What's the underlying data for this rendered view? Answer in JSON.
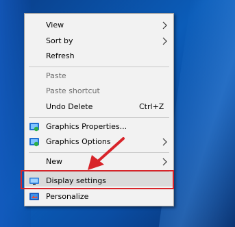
{
  "desktop": {
    "accent_color": "#0b5cb8"
  },
  "context_menu": {
    "items": [
      {
        "label": "View",
        "submenu": true
      },
      {
        "label": "Sort by",
        "submenu": true
      },
      {
        "label": "Refresh"
      },
      {
        "label": "Paste",
        "disabled": true
      },
      {
        "label": "Paste shortcut",
        "disabled": true
      },
      {
        "label": "Undo Delete",
        "shortcut": "Ctrl+Z"
      },
      {
        "label": "Graphics Properties...",
        "icon": "graphics-icon"
      },
      {
        "label": "Graphics Options",
        "icon": "graphics-icon",
        "submenu": true
      },
      {
        "label": "New",
        "submenu": true
      },
      {
        "label": "Display settings",
        "icon": "display-icon",
        "highlighted": true
      },
      {
        "label": "Personalize",
        "icon": "personalize-icon"
      }
    ]
  },
  "annotation": {
    "color": "#d8242a",
    "target": "Display settings"
  }
}
